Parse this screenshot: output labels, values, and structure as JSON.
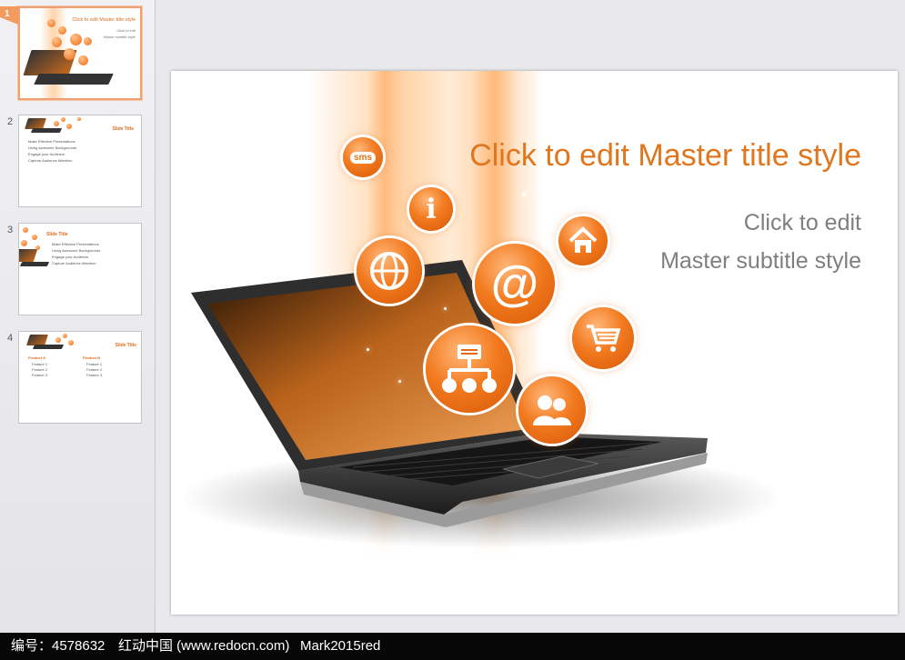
{
  "thumbnails": [
    {
      "number": "1",
      "title": "Click to edit Master title style",
      "subtitle_line1": "Click to edit",
      "subtitle_line2": "Master subtitle style"
    },
    {
      "number": "2",
      "title": "Slide Title",
      "bullets": [
        "Make Effective Presentations",
        "Using Awesome Backgrounds",
        "Engage your Audience",
        "Capture Audience Attention"
      ]
    },
    {
      "number": "3",
      "title": "Slide Title",
      "bullets": [
        "Make Effective Presentations",
        "Using Awesome Backgrounds",
        "Engage your Audience",
        "Capture Audience Attention"
      ]
    },
    {
      "number": "4",
      "title": "Slide Title",
      "col1_head": "Product A",
      "col2_head": "Product B",
      "col1_items": [
        "Feature 1",
        "Feature 2",
        "Feature 3"
      ],
      "col2_items": [
        "Feature 1",
        "Feature 2",
        "Feature 3"
      ]
    }
  ],
  "slide": {
    "title": "Click to edit Master title style",
    "subtitle_line1": "Click to edit",
    "subtitle_line2": "Master subtitle style",
    "sms_label": "sms",
    "info_label": "i",
    "at_label": "@"
  },
  "status_bar": {
    "id_text": "编号：4578632",
    "site_text": "红动中国 (www.redocn.com)",
    "author_text": "Mark2015red"
  },
  "colors": {
    "accent": "#e0761e",
    "subtitle": "#7f7f7f",
    "orb": "#f27a1f"
  }
}
